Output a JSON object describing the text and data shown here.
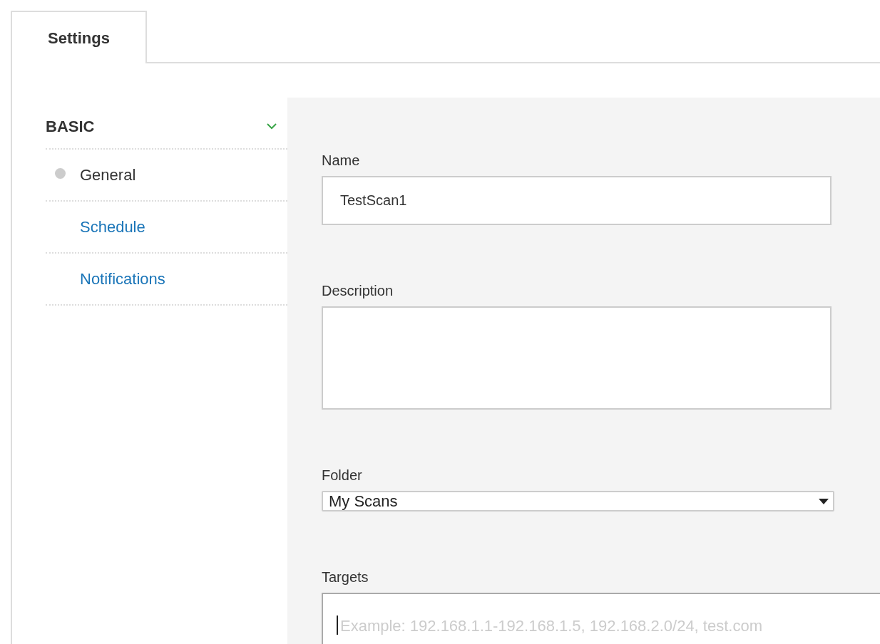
{
  "tabs": [
    {
      "label": "Settings",
      "selected": true
    }
  ],
  "sidebar": {
    "sections": [
      {
        "title": "BASIC",
        "expanded": true,
        "items": [
          {
            "label": "General",
            "selected": true
          },
          {
            "label": "Schedule",
            "selected": false
          },
          {
            "label": "Notifications",
            "selected": false
          }
        ]
      }
    ]
  },
  "form": {
    "fields": [
      {
        "kind": "text",
        "label": "Name",
        "value": "TestScan1"
      },
      {
        "kind": "textarea",
        "label": "Description"
      },
      {
        "kind": "select",
        "label": "Folder",
        "value": "My Scans"
      },
      {
        "kind": "wide-textarea",
        "label": "Targets",
        "placeholder": "Example: 192.168.1.1-192.168.1.5, 192.168.2.0/24, test.com",
        "focused": true
      }
    ]
  }
}
